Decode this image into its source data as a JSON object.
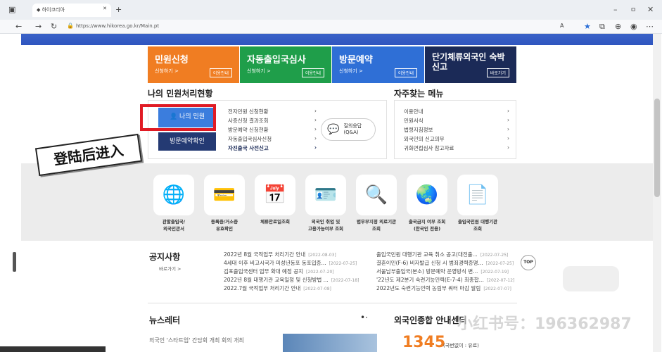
{
  "browser": {
    "tab_title": "하이코리아",
    "url": "https://www.hikorea.go.kr/Main.pt",
    "zoom": "A",
    "window_buttons": [
      "–",
      "ㅁ",
      "✕"
    ]
  },
  "services": [
    {
      "title": "민원신청",
      "sub": "신청하기 >",
      "badge": "이용안내",
      "color": "#f07d22"
    },
    {
      "title": "자동출입국심사",
      "sub": "신청하기 >",
      "badge": "이용안내",
      "color": "#1f9e4a"
    },
    {
      "title": "방문예약",
      "sub": "신청하기 >",
      "badge": "이용안내",
      "color": "#2f6fd6"
    },
    {
      "title": "단기체류외국인 숙박신고",
      "sub": "",
      "badge": "바로가기",
      "color": "#1b2a57"
    }
  ],
  "status": {
    "title": "나의 민원처리현황",
    "my_button": "나의 민원",
    "visit_button": "방문예약확인",
    "links": [
      "전자민원 신청현황",
      "사증신청 결과조회",
      "방문예약 신청현황",
      "자동출입국심사신청",
      "자진출국 사전신고"
    ],
    "qa_label": "질의응답 (Q&A)"
  },
  "faq": {
    "title": "자주찾는 메뉴",
    "links": [
      "이용안내",
      "민원서식",
      "법령지침정보",
      "외국인의 신고의무",
      "귀화면접심사 참고자료"
    ]
  },
  "annotation": "登陆后进入",
  "icons": [
    {
      "label": "관할출입국/\n외국인관서",
      "icon": "globe-icon"
    },
    {
      "label": "등록증/거소증\n유효확인",
      "icon": "card-icon"
    },
    {
      "label": "체류만료일조회",
      "icon": "calendar-icon"
    },
    {
      "label": "외국인 취업 및\n고용가능여부 조회",
      "icon": "id-card-icon"
    },
    {
      "label": "법무부지정 의료기관\n조회",
      "icon": "search-doc-icon"
    },
    {
      "label": "출국금지 여부 조회\n(한국인 전용)",
      "icon": "globe-search-icon"
    },
    {
      "label": "출입국민원 대행기관\n조회",
      "icon": "document-shield-icon"
    }
  ],
  "notices": {
    "title": "공지사항",
    "more": "바로가기 >",
    "left": [
      {
        "text": "2022년 8월 국적업무 처리기간 안내",
        "date": "[2022-08-03]"
      },
      {
        "text": "4세대 이후 비고시국가 미성년동포 동포입증...",
        "date": "[2022-07-25]"
      },
      {
        "text": "김포출입국센터 업무 확대 예정 공지",
        "date": "[2022-07-20]"
      },
      {
        "text": "2022년 8월 대행기관 교육일정 및 신청방법 ...",
        "date": "[2022-07-18]"
      },
      {
        "text": "2022.7월 국적업무 처리기간 안내",
        "date": "[2022-07-08]"
      }
    ],
    "right": [
      {
        "text": "출입국민원 대행기관 교육 취소 공고(대전출...",
        "date": "[2022-07-25]"
      },
      {
        "text": "결혼이민(F-6) 비자발급 신청 시 범죄경력증명...",
        "date": "[2022-07-25]"
      },
      {
        "text": "서울남부출입국(본소) 방문예약 운영방식 변...",
        "date": "[2022-07-19]"
      },
      {
        "text": "'22년도 제2분기 숙련기능인력(E-7-4) 최종합...",
        "date": "[2022-07-12]"
      },
      {
        "text": "2022년도 숙련기능인력 농림부 쿼터 마감 알림",
        "date": "[2022-07-07]"
      }
    ],
    "top_button": "TOP"
  },
  "newsletter": {
    "title": "뉴스레터",
    "item": "외국인 '스타트업' 간담회 개최 회의 개최"
  },
  "center": {
    "title": "외국인종합 안내센터",
    "phone": "1345",
    "note": "(국번없이 : 유료)"
  },
  "watermark": "小红书号：196362987"
}
